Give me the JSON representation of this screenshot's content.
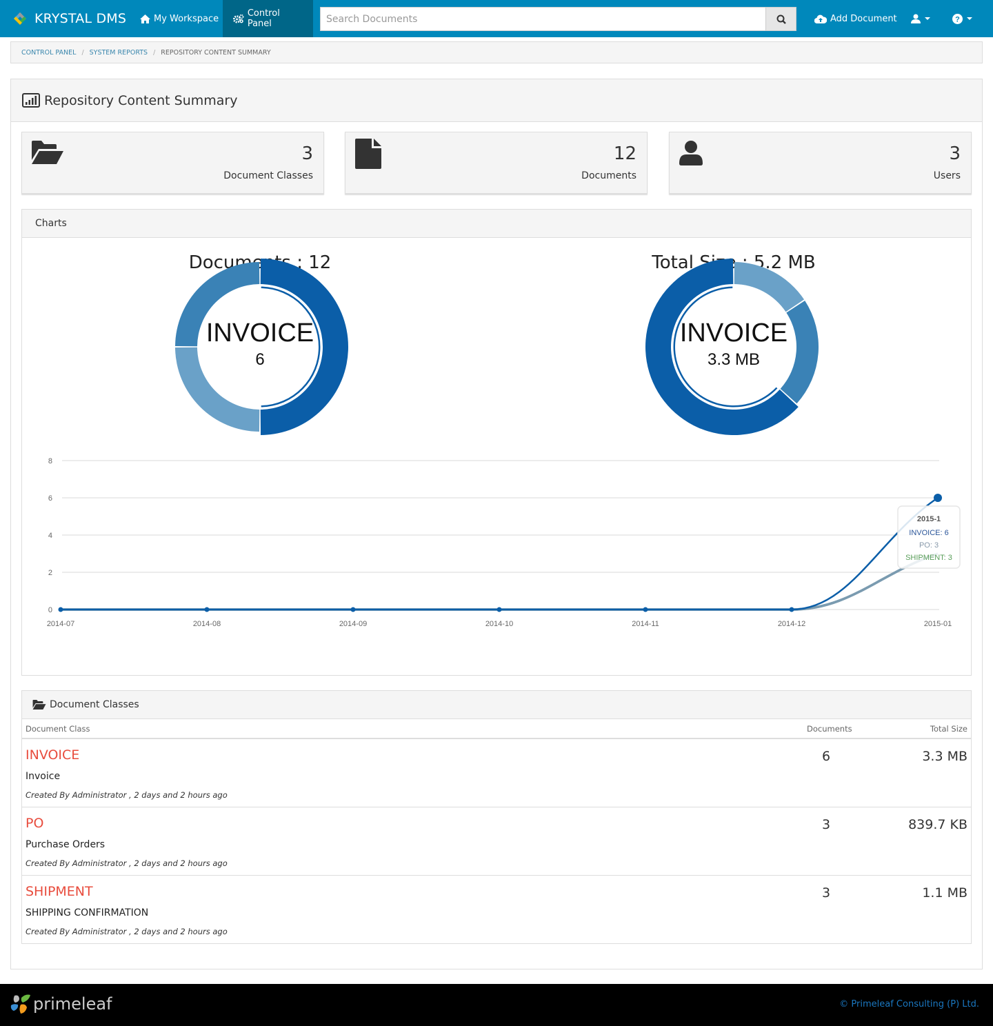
{
  "navbar": {
    "brand": "KRYSTAL DMS",
    "items": [
      {
        "label": "My Workspace",
        "icon": "home-icon",
        "active": false
      },
      {
        "label": "Control Panel",
        "icon": "gears-icon",
        "active": true
      }
    ],
    "search_placeholder": "Search Documents",
    "add_document": "Add Document",
    "user_menu_icon": "user-icon",
    "help_menu_icon": "question-circle-icon"
  },
  "breadcrumb": [
    "CONTROL PANEL",
    "SYSTEM REPORTS",
    "REPOSITORY CONTENT SUMMARY"
  ],
  "page": {
    "title": "Repository Content Summary",
    "title_icon": "bar-chart-icon"
  },
  "stats": [
    {
      "icon": "folder-open-icon",
      "value": "3",
      "label": "Document Classes"
    },
    {
      "icon": "file-icon",
      "value": "12",
      "label": "Documents"
    },
    {
      "icon": "user-icon",
      "value": "3",
      "label": "Users"
    }
  ],
  "charts_panel": {
    "title": "Charts"
  },
  "chart_data": [
    {
      "type": "pie",
      "title": "Documents : 12",
      "center_label": "INVOICE",
      "center_value": "6",
      "categories": [
        "INVOICE",
        "PO",
        "SHIPMENT"
      ],
      "values": [
        6,
        3,
        3
      ],
      "colors": [
        "#0b5ea8",
        "#6aa1c8",
        "#3a82b6"
      ]
    },
    {
      "type": "pie",
      "title": "Total Size : 5.2 MB",
      "center_label": "INVOICE",
      "center_value": "3.3 MB",
      "categories": [
        "INVOICE",
        "PO",
        "SHIPMENT"
      ],
      "values": [
        3.3,
        0.82,
        1.1
      ],
      "colors": [
        "#0b5ea8",
        "#6aa1c8",
        "#3a82b6"
      ]
    },
    {
      "type": "line",
      "x": [
        "2014-07",
        "2014-08",
        "2014-09",
        "2014-10",
        "2014-11",
        "2014-12",
        "2015-01"
      ],
      "ylim": [
        0,
        8
      ],
      "yticks": [
        0,
        2,
        4,
        6,
        8
      ],
      "grid": true,
      "series": [
        {
          "name": "INVOICE",
          "values": [
            0,
            0,
            0,
            0,
            0,
            0,
            6
          ],
          "color": "#0b5ea8"
        },
        {
          "name": "PO",
          "values": [
            0,
            0,
            0,
            0,
            0,
            0,
            3
          ],
          "color": "#7a9bb0"
        },
        {
          "name": "SHIPMENT",
          "values": [
            0,
            0,
            0,
            0,
            0,
            0,
            3
          ],
          "color": "#5a9e5a"
        }
      ],
      "tooltip": {
        "title": "2015-1",
        "lines": [
          {
            "text": "INVOICE: 6",
            "color": "#2a5599"
          },
          {
            "text": "PO: 3",
            "color": "#8899aa"
          },
          {
            "text": "SHIPMENT: 3",
            "color": "#5a9e5a"
          }
        ]
      }
    }
  ],
  "document_classes": {
    "title": "Document Classes",
    "icon": "folder-open-icon",
    "columns": [
      "Document Class",
      "Documents",
      "Total Size"
    ],
    "rows": [
      {
        "name": "INVOICE",
        "description": "Invoice",
        "meta": "Created By Administrator , 2 days and 2 hours ago",
        "documents": "6",
        "size": "3.3 MB"
      },
      {
        "name": "PO",
        "description": "Purchase Orders",
        "meta": "Created By Administrator , 2 days and 2 hours ago",
        "documents": "3",
        "size": "839.7 KB"
      },
      {
        "name": "SHIPMENT",
        "description": "SHIPPING CONFIRMATION",
        "meta": "Created By Administrator , 2 days and 2 hours ago",
        "documents": "3",
        "size": "1.1 MB"
      }
    ]
  },
  "footer": {
    "logo_text": "primeleaf",
    "copyright": "© Primeleaf Consulting (P) Ltd."
  }
}
